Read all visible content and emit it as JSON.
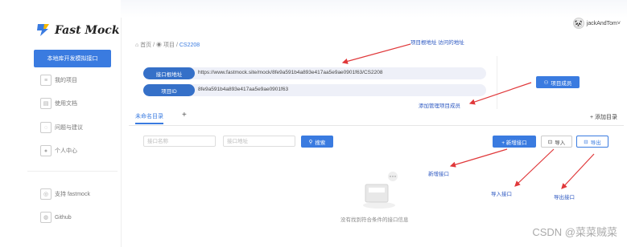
{
  "app": {
    "logo_text": "Fast Mock"
  },
  "sidebar": {
    "primary_label": "本地库开发模拟接口",
    "items": [
      {
        "label": "我的项目",
        "icon": "list-icon"
      },
      {
        "label": "使用文档",
        "icon": "doc-icon"
      },
      {
        "label": "问题与建议",
        "icon": "feedback-icon"
      },
      {
        "label": "个人中心",
        "icon": "user-icon"
      }
    ],
    "bottom_items": [
      {
        "label": "支持 fastmock",
        "icon": "support-icon"
      },
      {
        "label": "Github",
        "icon": "github-icon"
      }
    ]
  },
  "header": {
    "username": "jackAndTom",
    "caret": "˅"
  },
  "breadcrumb": {
    "home": "首页",
    "sep1": "/",
    "project": "项目",
    "sep2": "/",
    "current": "CS2208"
  },
  "project": {
    "root_label": "接口根地址",
    "root_value": "https://www.fastmock.site/mock/8fe9a591b4a893e417aa5e9ae0901f63/CS2208",
    "id_label": "项目ID",
    "id_value": "8fe9a591b4a893e417aa5e9ae0901f63",
    "members_button": "项目成员"
  },
  "tabs": {
    "active": "未命名目录",
    "add_tab": "+",
    "add_dir": "+ 添加目录"
  },
  "filters": {
    "name_placeholder": "接口名称",
    "path_placeholder": "接口地址",
    "search_button": "搜索",
    "new_button": "+ 新增接口",
    "import_button": "导入",
    "export_button": "导出"
  },
  "empty": {
    "message": "没有找到符合条件的接口信息"
  },
  "annotations": {
    "root": "项目根地址  访问的地址",
    "members": "添加管理项目成员",
    "new": "新增接口",
    "import": "导入接口",
    "export": "导出接口"
  },
  "watermark": "CSDN @菜菜贼菜",
  "colors": {
    "primary": "#3a7be0",
    "annotation": "#2a56c0",
    "arrow": "#e0383a"
  }
}
